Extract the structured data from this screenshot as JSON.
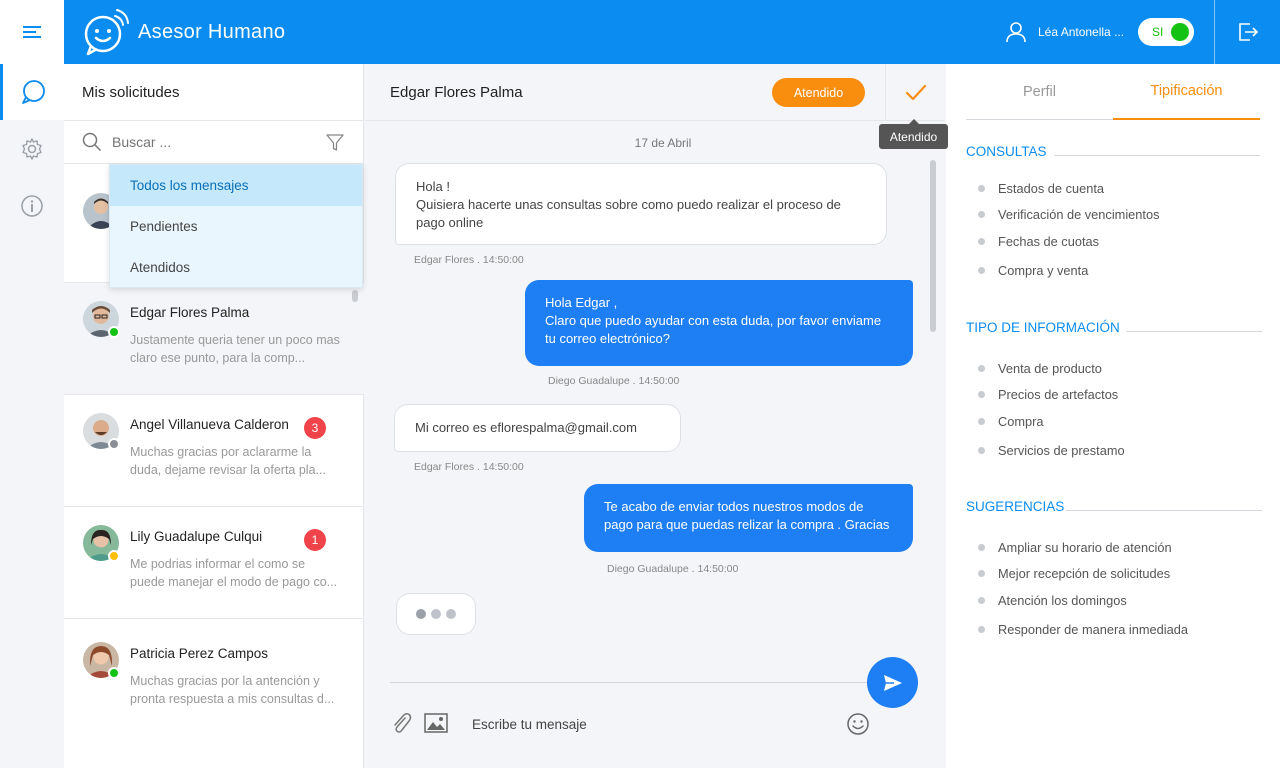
{
  "app": {
    "title": "Asesor Humano",
    "user_name": "Léa Antonella ...",
    "toggle_label": "SI",
    "accent_color": "#0b8cf0",
    "status_colors": {
      "online": "#14c214",
      "away": "#ffbf00",
      "offline": "#8a8f96"
    }
  },
  "requests": {
    "title": "Mis solicitudes",
    "search_placeholder": "Buscar ...",
    "filter_options": [
      "Todos los mensajes",
      "Pendientes",
      "Atendidos"
    ],
    "items": [
      {
        "name": "Edgar Flores Palma",
        "snippet": "Justamente queria tener un poco mas claro ese punto, para la comp...",
        "status": "online",
        "badge": null
      },
      {
        "name": "Angel Villanueva Calderon",
        "snippet": "Muchas gracias por aclararme la duda, dejame revisar la oferta pla...",
        "status": "offline",
        "badge": "3"
      },
      {
        "name": "Lily Guadalupe Culqui",
        "snippet": "Me podrias informar el como se puede manejar el modo de pago co...",
        "status": "away",
        "badge": "1"
      },
      {
        "name": "Patricia Perez Campos",
        "snippet": "Muchas gracias por la antención y pronta respuesta a mis consultas d...",
        "status": "online",
        "badge": null
      }
    ]
  },
  "chat": {
    "contact_name": "Edgar Flores Palma",
    "status_button": "Atendido",
    "tooltip": "Atendido",
    "date": "17 de Abril",
    "messages": [
      {
        "direction": "in",
        "lines": [
          "Hola !",
          "Quisiera hacerte unas consultas sobre como puedo realizar el proceso de pago online"
        ],
        "meta": "Edgar Flores . 14:50:00"
      },
      {
        "direction": "out",
        "lines": [
          "Hola Edgar ,",
          "Claro que puedo ayudar con esta duda, por favor enviame tu correo electrónico?"
        ],
        "meta": "Diego Guadalupe . 14:50:00"
      },
      {
        "direction": "in",
        "lines": [
          "Mi correo es eflorespalma@gmail.com"
        ],
        "meta": "Edgar Flores . 14:50:00"
      },
      {
        "direction": "out",
        "lines": [
          "Te acabo de enviar todos nuestros modos de pago para que puedas relizar la compra . Gracias"
        ],
        "meta": "Diego Guadalupe . 14:50:00"
      }
    ],
    "input_placeholder": "Escribe tu mensaje"
  },
  "tipificacion": {
    "tabs": [
      "Perfil",
      "Tipificación"
    ],
    "active_tab": "Tipificación",
    "sections": [
      {
        "title": "CONSULTAS",
        "items": [
          "Estados de cuenta",
          "Verificación de vencimientos",
          "Fechas de cuotas",
          "Compra y venta"
        ]
      },
      {
        "title": "TIPO DE INFORMACIÓN",
        "items": [
          "Venta de producto",
          "Precios de artefactos",
          "Compra",
          "Servicios de prestamo"
        ]
      },
      {
        "title": "SUGERENCIAS",
        "items": [
          "Ampliar su horario de atención",
          "Mejor recepción de solicitudes",
          "Atención los domingos",
          "Responder de manera inmediada"
        ]
      }
    ]
  }
}
